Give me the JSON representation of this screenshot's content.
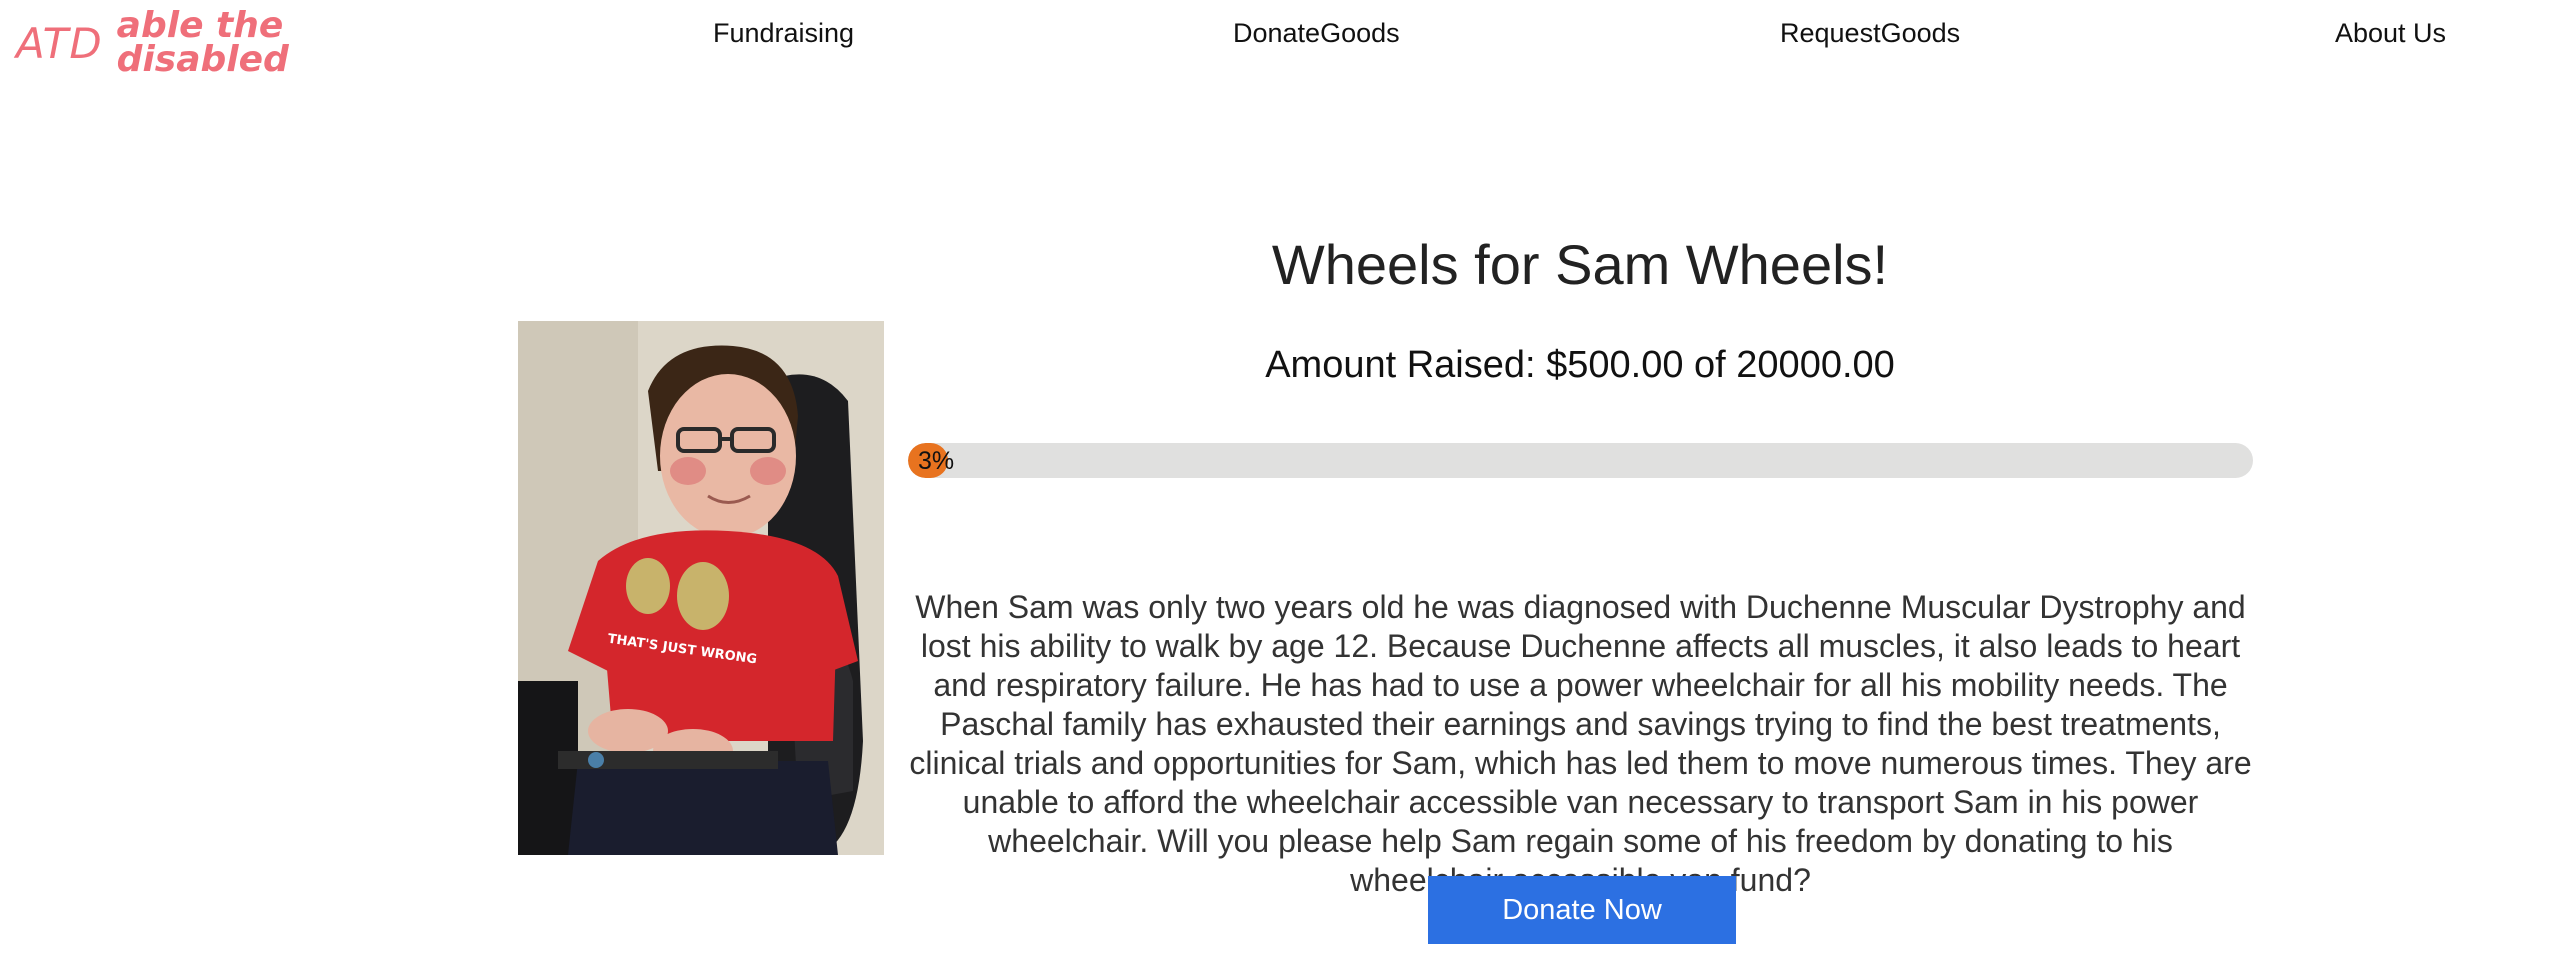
{
  "logo": {
    "abbr": "ATD",
    "line1": "able the",
    "line2": "disabled",
    "color": "#ef6f7a"
  },
  "nav": {
    "fundraising": "Fundraising",
    "donate_goods": "DonateGoods",
    "request_goods": "RequestGoods",
    "about": "About Us"
  },
  "campaign": {
    "title": "Wheels for Sam Wheels!",
    "amount_raised": "Amount Raised: $500.00 of 20000.00",
    "progress_percent": 3,
    "progress_label": "3%",
    "progress_color": "#e8731f",
    "description": "When Sam was only two years old he was diagnosed with Duchenne Muscular Dystrophy and lost his ability to walk by age 12. Because Duchenne affects all muscles, it also leads to heart and respiratory failure. He has had to use a power wheelchair for all his mobility needs. The Paschal family has exhausted their earnings and savings trying to find the best treatments, clinical trials and opportunities for Sam, which has led them to move numerous times. They are unable to afford the wheelchair accessible van necessary to transport Sam in his power wheelchair. Will you please help Sam regain some of his freedom by donating to his wheelchair accessible van fund?",
    "photo_shirt_text": "THAT'S JUST WRONG",
    "donate_label": "Donate Now",
    "donate_color": "#2c70e2"
  }
}
